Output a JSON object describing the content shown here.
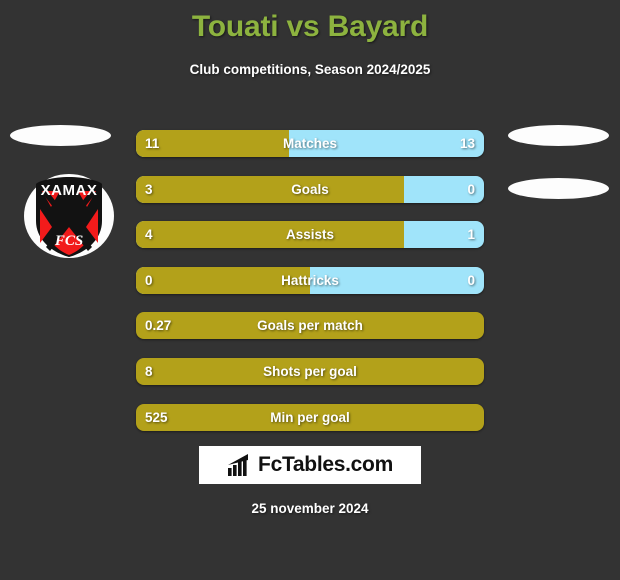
{
  "header": {
    "title": "Touati vs Bayard",
    "subtitle": "Club competitions, Season 2024/2025",
    "title_color": "#8DB33F"
  },
  "colors": {
    "background": "#333333",
    "home_bar": "#B3A11A",
    "away_bar": "#A0E4FA",
    "text": "#FFFFFF"
  },
  "crest": {
    "name": "Neuchatel Xamax FCS",
    "top_text": "XAMAX",
    "bottom_text": "FCS",
    "shield_color": "#111111",
    "accent_color": "#F21B1B"
  },
  "stats": [
    {
      "label": "Matches",
      "home": "11",
      "away": "13",
      "home_pct": 44.0,
      "two_sided": true
    },
    {
      "label": "Goals",
      "home": "3",
      "away": "0",
      "home_pct": 77.0,
      "two_sided": true
    },
    {
      "label": "Assists",
      "home": "4",
      "away": "1",
      "home_pct": 77.0,
      "two_sided": true
    },
    {
      "label": "Hattricks",
      "home": "0",
      "away": "0",
      "home_pct": 50.0,
      "two_sided": true
    },
    {
      "label": "Goals per match",
      "home": "0.27",
      "away": "",
      "home_pct": 100.0,
      "two_sided": false
    },
    {
      "label": "Shots per goal",
      "home": "8",
      "away": "",
      "home_pct": 100.0,
      "two_sided": false
    },
    {
      "label": "Min per goal",
      "home": "525",
      "away": "",
      "home_pct": 100.0,
      "two_sided": false
    }
  ],
  "footer": {
    "brand": "FcTables.com",
    "date": "25 november 2024"
  }
}
